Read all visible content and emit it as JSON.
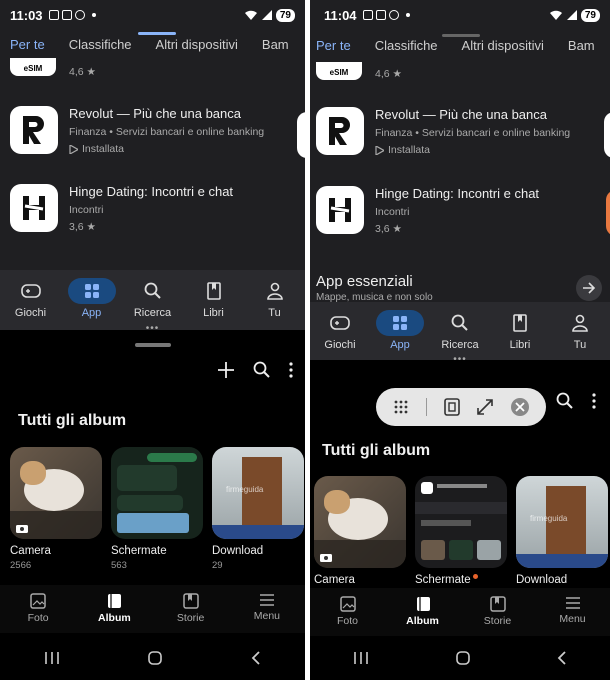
{
  "left": {
    "status": {
      "time": "11:03",
      "battery": "79"
    },
    "tabs": [
      "Per te",
      "Classifiche",
      "Altri dispositivi",
      "Bam"
    ],
    "apps": [
      {
        "rating": "4,6"
      },
      {
        "name": "Revolut — Più che una banca",
        "category": "Finanza",
        "sub": "Servizi bancari e online banking",
        "installed": "Installata"
      },
      {
        "name": "Hinge Dating: Incontri e chat",
        "category": "Incontri",
        "rating": "3,6"
      }
    ],
    "nav": [
      "Giochi",
      "App",
      "Ricerca",
      "Libri",
      "Tu"
    ],
    "gallery": {
      "title": "Tutti gli album",
      "albums": [
        {
          "name": "Camera",
          "count": "2566"
        },
        {
          "name": "Schermate",
          "count": "563"
        },
        {
          "name": "Download",
          "count": "29"
        }
      ],
      "nav": [
        "Foto",
        "Album",
        "Storie",
        "Menu"
      ]
    }
  },
  "right": {
    "status": {
      "time": "11:04",
      "battery": "79"
    },
    "tabs": [
      "Per te",
      "Classifiche",
      "Altri dispositivi",
      "Bam"
    ],
    "apps": [
      {
        "rating": "4,6"
      },
      {
        "name": "Revolut — Più che una banca",
        "category": "Finanza",
        "sub": "Servizi bancari e online banking",
        "installed": "Installata"
      },
      {
        "name": "Hinge Dating: Incontri e chat",
        "category": "Incontri",
        "rating": "3,6"
      }
    ],
    "essential": {
      "title": "App essenziali",
      "sub": "Mappe, musica e non solo"
    },
    "nav": [
      "Giochi",
      "App",
      "Ricerca",
      "Libri",
      "Tu"
    ],
    "gallery": {
      "title": "Tutti gli album",
      "albums": [
        {
          "name": "Camera"
        },
        {
          "name": "Schermate"
        },
        {
          "name": "Download"
        }
      ],
      "nav": [
        "Foto",
        "Album",
        "Storie",
        "Menu"
      ]
    }
  },
  "common": {
    "esim_label": "eSIM",
    "star": "★",
    "separator": "•",
    "watermark": "firmeguida",
    "colors": {
      "accent": "#8ab4f8",
      "nav_active_bg": "#1a4a80"
    }
  }
}
